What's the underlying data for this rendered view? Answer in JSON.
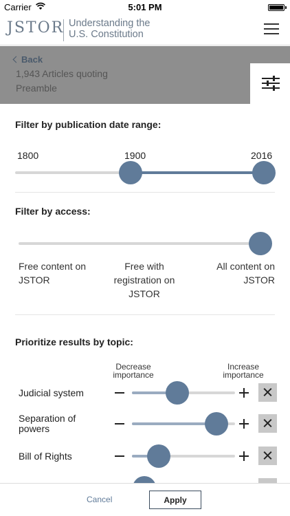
{
  "status_bar": {
    "carrier": "Carrier",
    "time": "5:01 PM"
  },
  "header": {
    "logo": "JSTOR",
    "subtitle_line1": "Understanding the",
    "subtitle_line2": "U.S. Constitution"
  },
  "back_bar": {
    "back_label": "Back",
    "results_line1": "1,943 Articles quoting",
    "results_line2": "Preamble"
  },
  "date_filter": {
    "title": "Filter by publication date range:",
    "labels": [
      "1800",
      "1900",
      "2016"
    ],
    "range_min": 1800,
    "range_max": 2016,
    "selected_start": 1900,
    "selected_end": 2016
  },
  "access_filter": {
    "title": "Filter by access:",
    "options": [
      [
        "Free content on",
        "JSTOR"
      ],
      [
        "Free with",
        "registration on",
        "JSTOR"
      ],
      [
        "All content on",
        "JSTOR"
      ]
    ],
    "selected_index": 2
  },
  "topics": {
    "title": "Prioritize results by topic:",
    "decrease_label": [
      "Decrease",
      "importance"
    ],
    "increase_label": [
      "Increase",
      "importance"
    ],
    "items": [
      {
        "name": [
          "Judicial system"
        ],
        "level": 0.44
      },
      {
        "name": [
          "Separation of",
          "powers"
        ],
        "level": 0.82
      },
      {
        "name": [
          "Bill of Rights"
        ],
        "level": 0.26
      },
      {
        "name": [
          ""
        ],
        "level": 0.12
      }
    ]
  },
  "footer": {
    "cancel_label": "Cancel",
    "apply_label": "Apply"
  },
  "colors": {
    "accent": "#607b99",
    "track": "#d7d7d7",
    "overlay": "#8e8e8e"
  }
}
